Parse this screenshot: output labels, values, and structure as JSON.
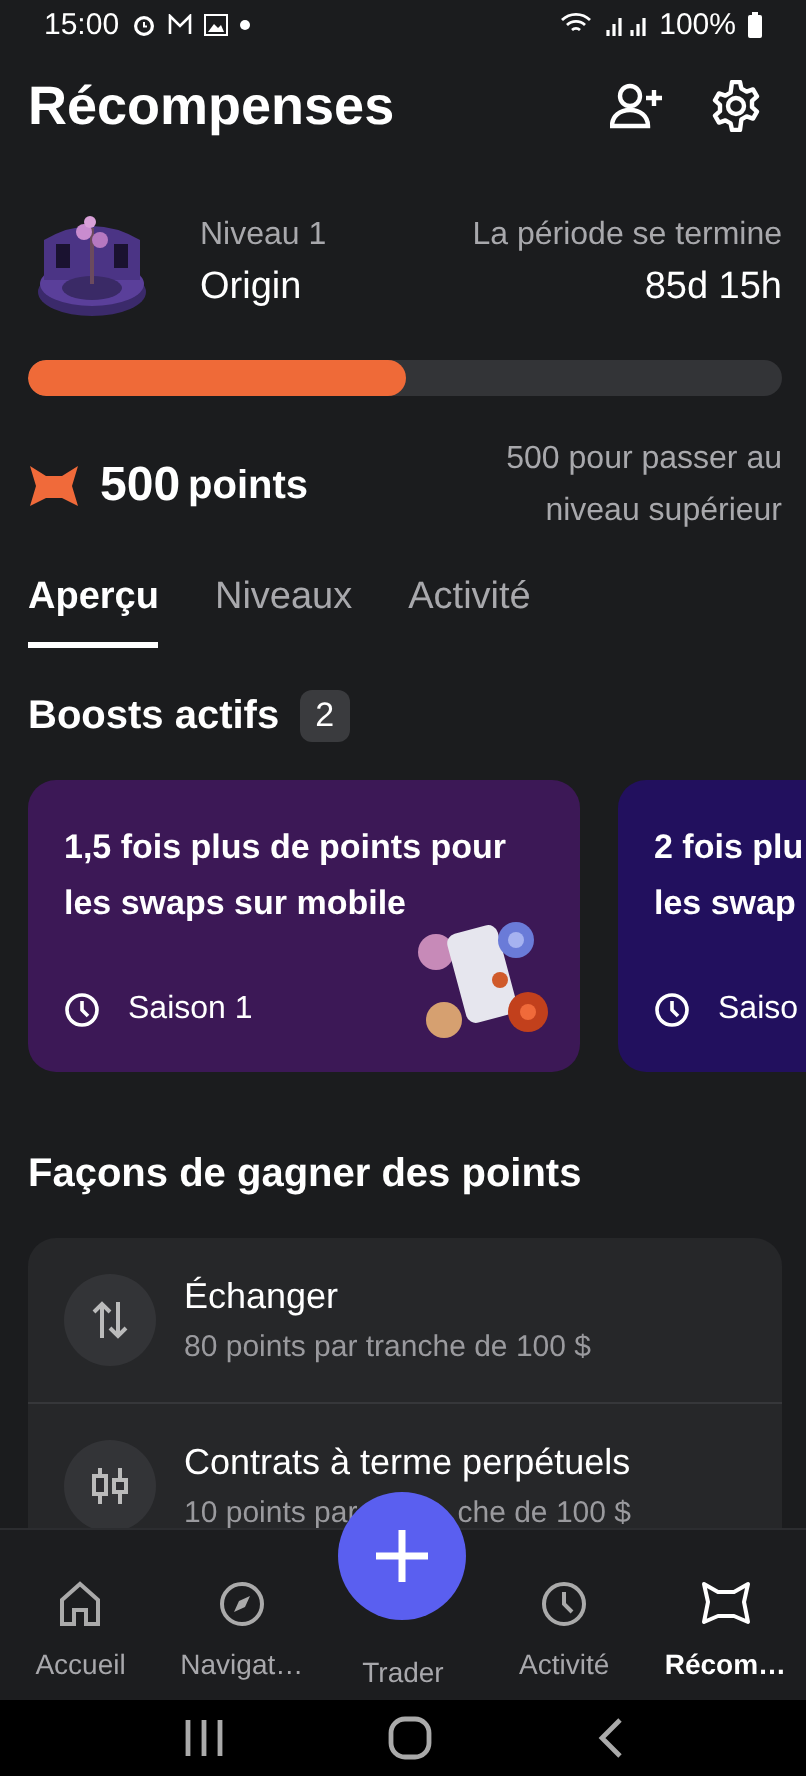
{
  "status_bar": {
    "time": "15:00",
    "battery": "100%"
  },
  "header": {
    "title": "Récompenses"
  },
  "level": {
    "tier": "Niveau 1",
    "name": "Origin",
    "period_label": "La période se termine",
    "period_value": "85d 15h",
    "progress": {
      "level": 0.5
    }
  },
  "points": {
    "value": "500",
    "unit": "points",
    "next": "500 pour passer au niveau supérieur"
  },
  "tabs": [
    {
      "label": "Aperçu",
      "selected": true
    },
    {
      "label": "Niveaux",
      "selected": false
    },
    {
      "label": "Activité",
      "selected": false
    }
  ],
  "boosts": {
    "title": "Boosts actifs",
    "count": "2",
    "cards": [
      {
        "lines": [
          "1,5 fois plus de points pour",
          "les swaps sur mobile"
        ],
        "season": "Saison 1",
        "color": "#3c1856",
        "art": true
      },
      {
        "lines": [
          "2 fois plu",
          "les swap"
        ],
        "season": "Saiso",
        "color": "#22105e",
        "art": false
      }
    ]
  },
  "ways": {
    "title": "Façons de gagner des points",
    "items": [
      {
        "kind": "swap",
        "title": "Échanger",
        "subtitle": [
          "80 points par tranche de 100 $"
        ]
      },
      {
        "kind": "perp",
        "title": "Contrats à terme perpétuels",
        "subtitle": [
          "10 points par",
          "che de 100 $"
        ]
      }
    ]
  },
  "nav": [
    {
      "kind": "home",
      "label": "Accueil",
      "selected": false
    },
    {
      "kind": "compass",
      "label": "Navigat…",
      "selected": false
    },
    {
      "kind": "trade",
      "label": "Trader",
      "selected": false
    },
    {
      "kind": "clock",
      "label": "Activité",
      "selected": false
    },
    {
      "kind": "rewards",
      "label": "Récom…",
      "selected": true
    }
  ]
}
